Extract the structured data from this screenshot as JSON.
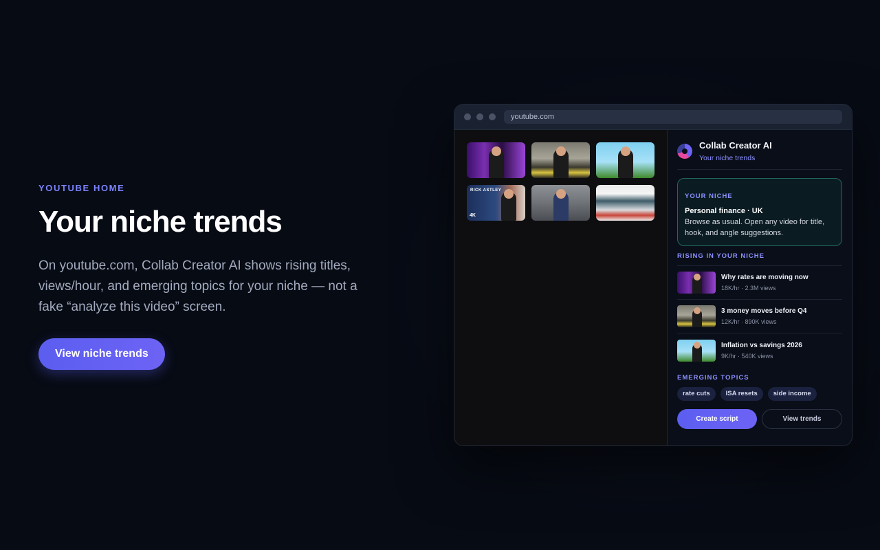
{
  "hero": {
    "eyebrow": "YOUTUBE HOME",
    "title": "Your niche trends",
    "description": "On youtube.com, Collab Creator AI shows rising titles, views/hour, and emerging topics for your niche — not a fake “analyze this video” screen.",
    "cta_label": "View niche trends"
  },
  "browser": {
    "url": "youtube.com",
    "thumbnails": [
      {
        "badge": ""
      },
      {
        "badge": ""
      },
      {
        "badge": ""
      },
      {
        "text": "RICK ASTLEY",
        "badge": "4K"
      },
      {
        "badge": ""
      },
      {
        "badge": ""
      }
    ]
  },
  "panel": {
    "app_name": "Collab Creator AI",
    "app_subtitle": "Your niche trends",
    "niche_card": {
      "label": "YOUR NICHE",
      "niche": "Personal finance · UK",
      "description": "Browse as usual. Open any video for title, hook, and angle suggestions."
    },
    "rising_label": "RISING IN YOUR NICHE",
    "rising": [
      {
        "title": "Why rates are moving now",
        "meta": "18K/hr · 2.3M views"
      },
      {
        "title": "3 money moves before Q4",
        "meta": "12K/hr · 890K views"
      },
      {
        "title": "Inflation vs savings 2026",
        "meta": "9K/hr · 540K views"
      }
    ],
    "topics_label": "EMERGING TOPICS",
    "topics": [
      "rate cuts",
      "ISA resets",
      "side income"
    ],
    "create_label": "Create script",
    "view_label": "View trends"
  },
  "colors": {
    "accent": "#6d63f5",
    "accent_text": "#7c83ff",
    "background": "#070b14",
    "card_border": "#1f6a5a"
  }
}
